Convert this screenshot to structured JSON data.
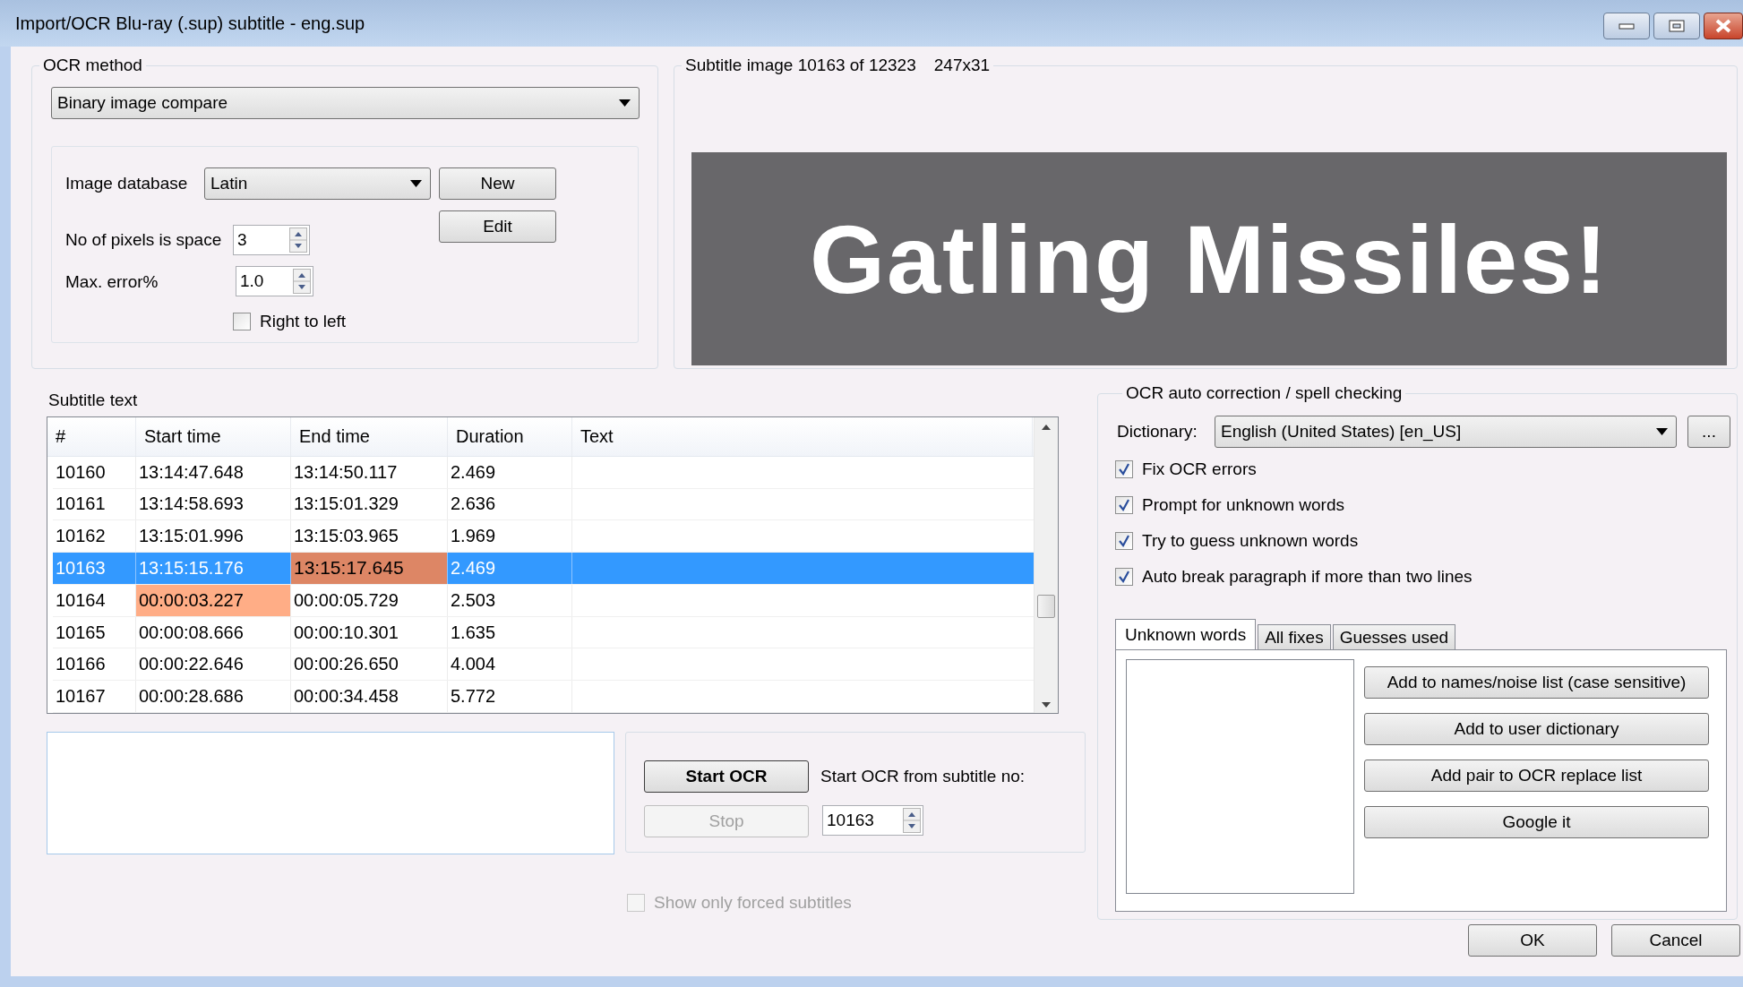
{
  "window": {
    "title": "Import/OCR Blu-ray (.sup) subtitle - eng.sup"
  },
  "ocr_method": {
    "label": "OCR method",
    "method": "Binary image compare",
    "image_database_label": "Image database",
    "image_database": "Latin",
    "new_button": "New",
    "edit_button": "Edit",
    "pixels_space_label": "No of pixels is space",
    "pixels_space": "3",
    "max_error_label": "Max. error%",
    "max_error": "1.0",
    "right_to_left": {
      "label": "Right to left",
      "checked": false
    }
  },
  "subtitle_image": {
    "label": "Subtitle image 10163 of 12323",
    "size": "247x31",
    "text": "Gatling Missiles!"
  },
  "subtitle_text": {
    "label": "Subtitle text",
    "columns": [
      "#",
      "Start time",
      "End time",
      "Duration",
      "Text"
    ],
    "rows": [
      {
        "number": "10160",
        "start": "13:14:47.648",
        "end": "13:14:50.117",
        "duration": "2.469",
        "selected": false,
        "start_marked": false,
        "end_marked": false
      },
      {
        "number": "10161",
        "start": "13:14:58.693",
        "end": "13:15:01.329",
        "duration": "2.636",
        "selected": false,
        "start_marked": false,
        "end_marked": false
      },
      {
        "number": "10162",
        "start": "13:15:01.996",
        "end": "13:15:03.965",
        "duration": "1.969",
        "selected": false,
        "start_marked": false,
        "end_marked": false
      },
      {
        "number": "10163",
        "start": "13:15:15.176",
        "end": "13:15:17.645",
        "duration": "2.469",
        "selected": true,
        "start_marked": false,
        "end_marked": true
      },
      {
        "number": "10164",
        "start": "00:00:03.227",
        "end": "00:00:05.729",
        "duration": "2.503",
        "selected": false,
        "start_marked": true,
        "end_marked": false
      },
      {
        "number": "10165",
        "start": "00:00:08.666",
        "end": "00:00:10.301",
        "duration": "1.635",
        "selected": false,
        "start_marked": false,
        "end_marked": false
      },
      {
        "number": "10166",
        "start": "00:00:22.646",
        "end": "00:00:26.650",
        "duration": "4.004",
        "selected": false,
        "start_marked": false,
        "end_marked": false
      },
      {
        "number": "10167",
        "start": "00:00:28.686",
        "end": "00:00:34.458",
        "duration": "5.772",
        "selected": false,
        "start_marked": false,
        "end_marked": false
      }
    ]
  },
  "ocr_controls": {
    "start_button": {
      "label": "Start OCR",
      "disabled": false
    },
    "stop_button": {
      "label": "Stop",
      "disabled": true
    },
    "start_from_label": "Start OCR from subtitle no:",
    "start_from": "10163"
  },
  "forced_only": {
    "label": "Show only forced subtitles",
    "checked": false,
    "disabled": true
  },
  "spell_check": {
    "label": "OCR auto correction / spell checking",
    "dictionary_label": "Dictionary:",
    "dictionary": "English (United States) [en_US]",
    "browse_button": "...",
    "options": [
      {
        "label": "Fix OCR errors",
        "checked": true
      },
      {
        "label": "Prompt for unknown words",
        "checked": true
      },
      {
        "label": "Try to guess unknown words",
        "checked": true
      },
      {
        "label": "Auto break paragraph if more than two lines",
        "checked": true
      }
    ],
    "tabs": [
      {
        "label": "Unknown words",
        "selected": true
      },
      {
        "label": "All fixes",
        "selected": false
      },
      {
        "label": "Guesses used",
        "selected": false
      }
    ],
    "buttons": [
      "Add to names/noise list (case sensitive)",
      "Add to user dictionary",
      "Add pair to OCR replace list",
      "Google it"
    ]
  },
  "dialog_buttons": [
    "OK",
    "Cancel"
  ]
}
